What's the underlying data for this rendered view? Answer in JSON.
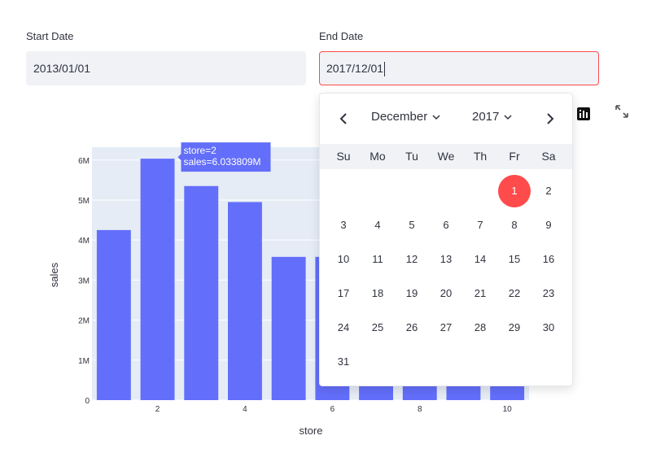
{
  "start_date": {
    "label": "Start Date",
    "value": "2013/01/01"
  },
  "end_date": {
    "label": "End Date",
    "value": "2017/12/01"
  },
  "toolbar": {
    "icons": [
      "bar-chart-icon",
      "fullscreen-icon"
    ]
  },
  "calendar": {
    "month": "December",
    "year": "2017",
    "weekdays": [
      "Su",
      "Mo",
      "Tu",
      "We",
      "Th",
      "Fr",
      "Sa"
    ],
    "start_weekday": 5,
    "days": [
      "1",
      "2",
      "3",
      "4",
      "5",
      "6",
      "7",
      "8",
      "9",
      "10",
      "11",
      "12",
      "13",
      "14",
      "15",
      "16",
      "17",
      "18",
      "19",
      "20",
      "21",
      "22",
      "23",
      "24",
      "25",
      "26",
      "27",
      "28",
      "29",
      "30",
      "31"
    ],
    "selected_day": "1",
    "accent_color": "#ff4b4b"
  },
  "chart_data": {
    "type": "bar",
    "xlabel": "store",
    "ylabel": "sales",
    "categories": [
      1,
      2,
      3,
      4,
      5,
      6,
      7,
      8,
      9,
      10
    ],
    "values": [
      4.25,
      6.033809,
      5.35,
      4.95,
      3.58,
      3.58,
      3.5,
      3.5,
      3.4,
      3.4
    ],
    "value_unit": "M",
    "ylim": [
      0,
      6.3
    ],
    "yticks": [
      "0",
      "1M",
      "2M",
      "3M",
      "4M",
      "5M",
      "6M"
    ],
    "xticks": [
      "2",
      "4",
      "6",
      "8",
      "10"
    ],
    "bar_color": "#636efa",
    "tooltip": {
      "line1": "store=2",
      "line2": "sales=6.033809M"
    }
  }
}
